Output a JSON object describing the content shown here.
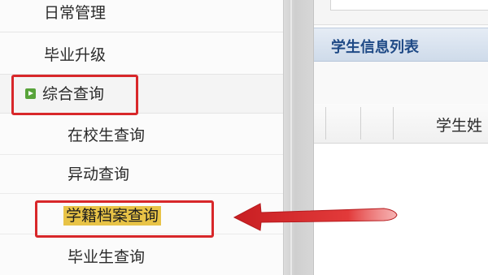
{
  "sidebar": {
    "items": [
      {
        "label": "日常管理"
      },
      {
        "label": "毕业升级"
      },
      {
        "label": "综合查询",
        "expanded": true,
        "icon": "expand-arrow-icon"
      },
      {
        "label": "在校生查询"
      },
      {
        "label": "异动查询"
      },
      {
        "label": "学籍档案查询",
        "selected": true
      },
      {
        "label": "毕业生查询"
      }
    ]
  },
  "panel": {
    "title": "学生信息列表",
    "grid_columns": [
      "",
      "",
      "学生姓"
    ]
  },
  "annotations": {
    "highlight_color": "#d8272a",
    "selected_bg": "#e8c346",
    "arrow": "red-arrow-pointing-left"
  },
  "colors": {
    "panel_title": "#1f4a86",
    "expand_icon": "#58a33a"
  }
}
